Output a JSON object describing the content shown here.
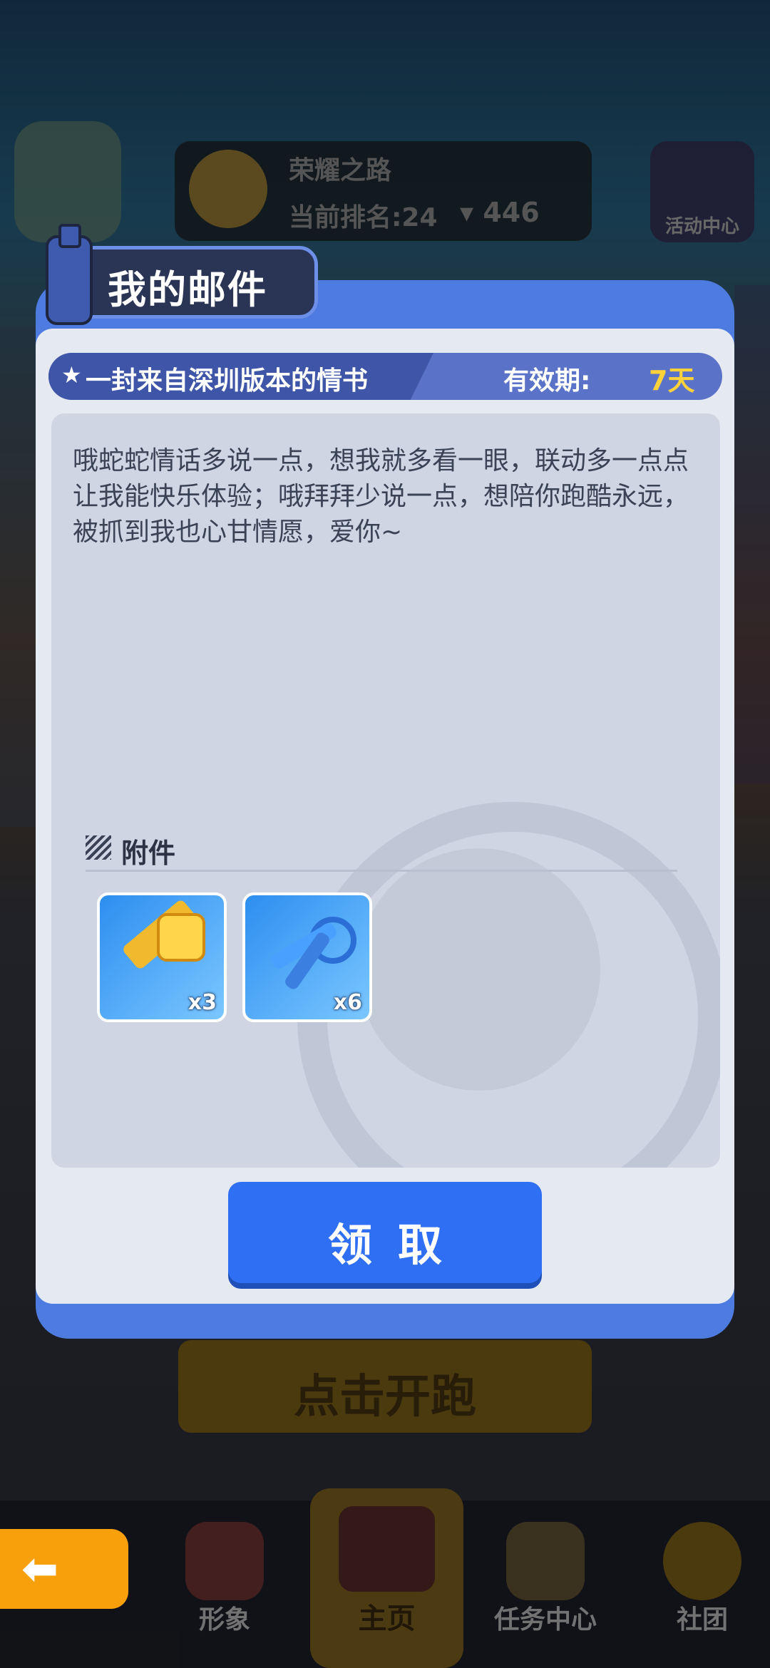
{
  "background": {
    "rank_panel": {
      "title": "荣耀之路",
      "rank_text": "当前排名:24",
      "trophies": "446"
    },
    "event_center_label": "活动中心",
    "start_button_label": "点击开跑"
  },
  "bottom_nav": {
    "items": [
      {
        "label": "形象"
      },
      {
        "label": "主页"
      },
      {
        "label": "任务中心"
      },
      {
        "label": "社团"
      }
    ]
  },
  "mail_dialog": {
    "title": "我的邮件",
    "mail_title": "一封来自深圳版本的情书",
    "validity_label": "有效期:",
    "validity_value": "7天",
    "message": "哦蛇蛇情话多说一点，想我就多看一眼，联动多一点点让我能快乐体验；哦拜拜少说一点，想陪你跑酷永远，被抓到我也心甘情愿，爱你~",
    "attachments_label": "附件",
    "attachments": [
      {
        "name": "gold-key-icon",
        "quantity": "x3"
      },
      {
        "name": "blue-keys-icon",
        "quantity": "x6"
      }
    ],
    "claim_button_label": "领取"
  },
  "colors": {
    "dialog_frame": "#4d7be0",
    "claim_button": "#2f6ff3",
    "validity_days": "#ffd23a",
    "back_button": "#f8a00c"
  }
}
